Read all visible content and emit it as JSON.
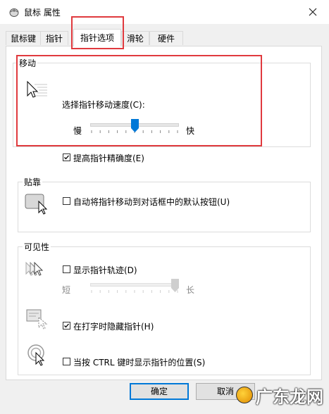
{
  "window": {
    "title": "鼠标 属性",
    "close_icon": "close-icon"
  },
  "tabs": [
    {
      "label": "鼠标键"
    },
    {
      "label": "指针"
    },
    {
      "label": "指针选项",
      "selected": true
    },
    {
      "label": "滑轮"
    },
    {
      "label": "硬件"
    }
  ],
  "motion": {
    "legend": "移动",
    "speed_label": "选择指针移动速度(C):",
    "slow_label": "慢",
    "fast_label": "快",
    "speed_level": 0.5,
    "precision_label": "提高指针精确度(E)",
    "precision_checked": true
  },
  "snap": {
    "legend": "贴靠",
    "snap_label": "自动将指针移动到对话框中的默认按钮(U)",
    "snap_checked": false
  },
  "visibility": {
    "legend": "可见性",
    "trails_label": "显示指针轨迹(D)",
    "trails_checked": false,
    "short_label": "短",
    "long_label": "长",
    "trails_level": 1.0,
    "hide_label": "在打字时隐藏指针(H)",
    "hide_checked": true,
    "ctrl_label": "当按 CTRL 键时显示指针的位置(S)",
    "ctrl_checked": false
  },
  "footer": {
    "ok_label": "确定",
    "cancel_label": "取消"
  },
  "watermark": {
    "text": "广东龙网"
  },
  "colors": {
    "highlight_box": "#e03a3e",
    "accent": "#0078d7"
  }
}
